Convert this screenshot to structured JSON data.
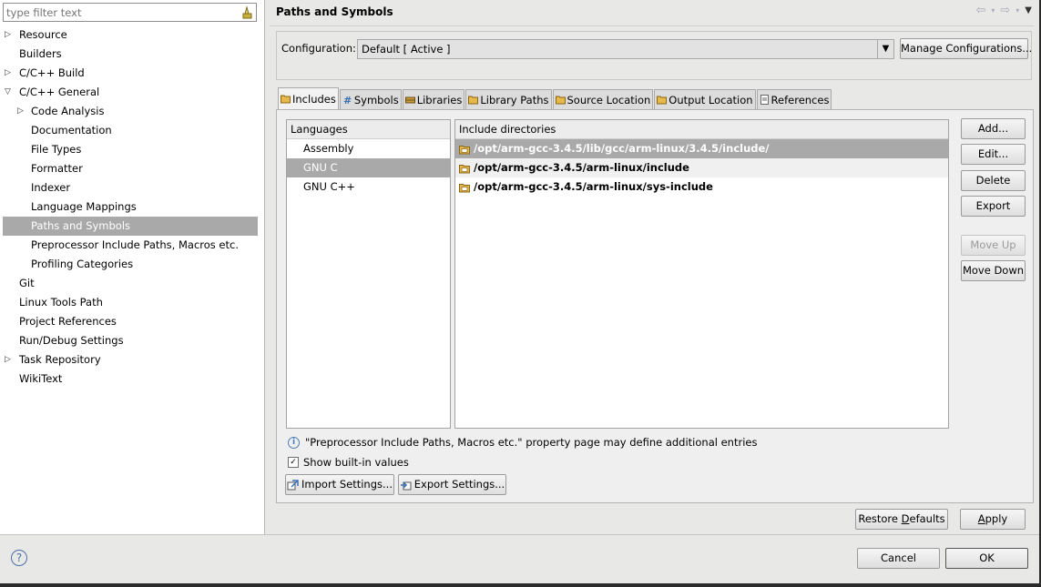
{
  "filter": {
    "placeholder": "type filter text"
  },
  "tree": [
    {
      "label": "Resource",
      "indent": 0,
      "arrow": "collapsed"
    },
    {
      "label": "Builders",
      "indent": 0,
      "arrow": ""
    },
    {
      "label": "C/C++ Build",
      "indent": 0,
      "arrow": "collapsed"
    },
    {
      "label": "C/C++ General",
      "indent": 0,
      "arrow": "expanded"
    },
    {
      "label": "Code Analysis",
      "indent": 1,
      "arrow": "collapsed"
    },
    {
      "label": "Documentation",
      "indent": 1,
      "arrow": ""
    },
    {
      "label": "File Types",
      "indent": 1,
      "arrow": ""
    },
    {
      "label": "Formatter",
      "indent": 1,
      "arrow": ""
    },
    {
      "label": "Indexer",
      "indent": 1,
      "arrow": ""
    },
    {
      "label": "Language Mappings",
      "indent": 1,
      "arrow": ""
    },
    {
      "label": "Paths and Symbols",
      "indent": 1,
      "arrow": "",
      "selected": true
    },
    {
      "label": "Preprocessor Include Paths, Macros etc.",
      "indent": 1,
      "arrow": ""
    },
    {
      "label": "Profiling Categories",
      "indent": 1,
      "arrow": ""
    },
    {
      "label": "Git",
      "indent": 0,
      "arrow": ""
    },
    {
      "label": "Linux Tools Path",
      "indent": 0,
      "arrow": ""
    },
    {
      "label": "Project References",
      "indent": 0,
      "arrow": ""
    },
    {
      "label": "Run/Debug Settings",
      "indent": 0,
      "arrow": ""
    },
    {
      "label": "Task Repository",
      "indent": 0,
      "arrow": "collapsed"
    },
    {
      "label": "WikiText",
      "indent": 0,
      "arrow": ""
    }
  ],
  "page": {
    "title": "Paths and Symbols"
  },
  "config": {
    "label": "Configuration:",
    "value": "Default  [ Active ]",
    "manage_label": "Manage Configurations..."
  },
  "tabs": [
    {
      "label": "Includes",
      "icon": "includes-icon",
      "active": true
    },
    {
      "label": "Symbols",
      "icon": "symbols-icon"
    },
    {
      "label": "Libraries",
      "icon": "libraries-icon"
    },
    {
      "label": "Library Paths",
      "icon": "library-paths-icon"
    },
    {
      "label": "Source Location",
      "icon": "source-location-icon"
    },
    {
      "label": "Output Location",
      "icon": "output-location-icon"
    },
    {
      "label": "References",
      "icon": "references-icon"
    }
  ],
  "languages": {
    "header": "Languages",
    "items": [
      {
        "label": "Assembly"
      },
      {
        "label": "GNU C",
        "selected": true
      },
      {
        "label": "GNU C++"
      }
    ]
  },
  "includes": {
    "header": "Include directories",
    "items": [
      {
        "label": "/opt/arm-gcc-3.4.5/lib/gcc/arm-linux/3.4.5/include/",
        "selected": true
      },
      {
        "label": "/opt/arm-gcc-3.4.5/arm-linux/include",
        "alt": true
      },
      {
        "label": "/opt/arm-gcc-3.4.5/arm-linux/sys-include"
      }
    ]
  },
  "side_buttons": {
    "add": "Add...",
    "edit": "Edit...",
    "delete": "Delete",
    "export": "Export",
    "move_up": "Move Up",
    "move_down": "Move Down"
  },
  "info_text": "\"Preprocessor Include Paths, Macros etc.\" property page may define additional entries",
  "show_builtin": {
    "label": "Show built-in values",
    "checked": true
  },
  "import_label": "Import Settings...",
  "export_label": "Export Settings...",
  "restore_prefix": "Restore ",
  "restore_underline": "D",
  "restore_suffix": "efaults",
  "apply_underline": "A",
  "apply_suffix": "pply",
  "cancel_label": "Cancel",
  "ok_label": "OK",
  "colors": {
    "selection": "#a9a9a9",
    "panel": "#e8e8e7",
    "folder_icon": "#d9a538"
  }
}
